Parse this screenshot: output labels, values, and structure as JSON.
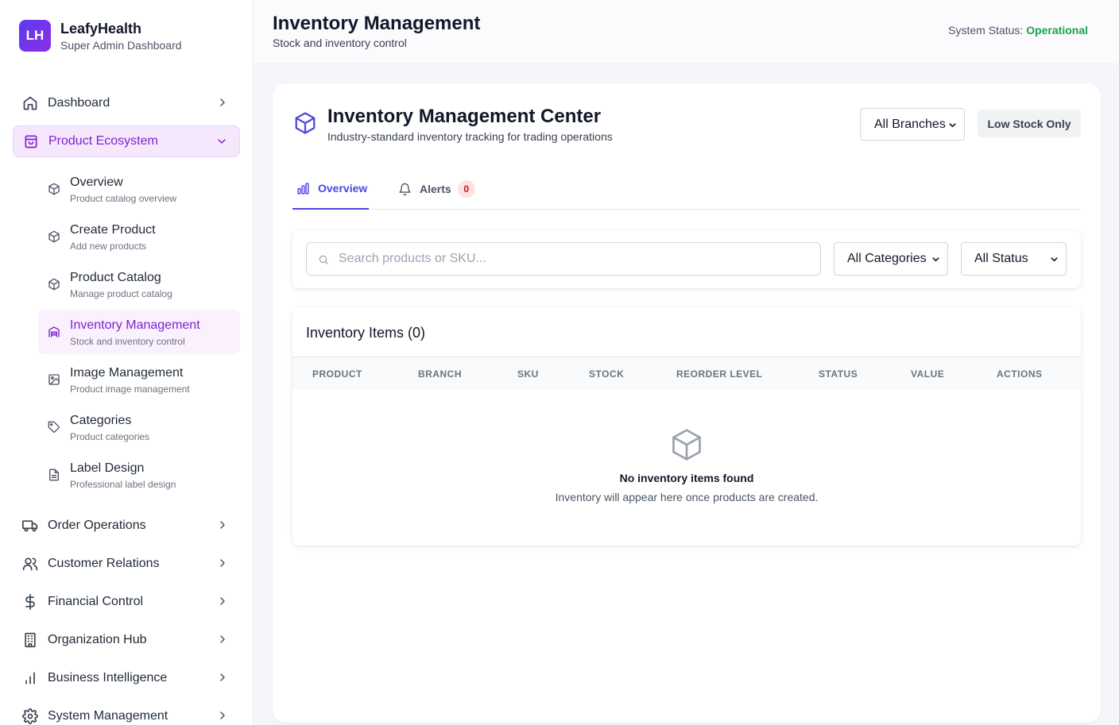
{
  "brand": {
    "logo": "LH",
    "name": "LeafyHealth",
    "subtitle": "Super Admin Dashboard"
  },
  "sidebar": {
    "top": {
      "label": "Dashboard",
      "icon": "home-icon"
    },
    "active_section": {
      "label": "Product Ecosystem",
      "icon": "shopping-bag-icon"
    },
    "sub_items": [
      {
        "title": "Overview",
        "desc": "Product catalog overview",
        "icon": "package-icon"
      },
      {
        "title": "Create Product",
        "desc": "Add new products",
        "icon": "package-icon"
      },
      {
        "title": "Product Catalog",
        "desc": "Manage product catalog",
        "icon": "package-icon"
      },
      {
        "title": "Inventory Management",
        "desc": "Stock and inventory control",
        "icon": "warehouse-icon",
        "active": true
      },
      {
        "title": "Image Management",
        "desc": "Product image management",
        "icon": "image-icon"
      },
      {
        "title": "Categories",
        "desc": "Product categories",
        "icon": "tag-icon"
      },
      {
        "title": "Label Design",
        "desc": "Professional label design",
        "icon": "file-text-icon"
      }
    ],
    "sections": [
      {
        "label": "Order Operations",
        "icon": "truck-icon"
      },
      {
        "label": "Customer Relations",
        "icon": "users-icon"
      },
      {
        "label": "Financial Control",
        "icon": "dollar-icon"
      },
      {
        "label": "Organization Hub",
        "icon": "building-icon"
      },
      {
        "label": "Business Intelligence",
        "icon": "bar-chart-icon"
      },
      {
        "label": "System Management",
        "icon": "gear-icon"
      }
    ]
  },
  "header": {
    "title": "Inventory Management",
    "subtitle": "Stock and inventory control",
    "status_label": "System Status:",
    "status_value": "Operational",
    "status_color": "#16a34a"
  },
  "main": {
    "title": "Inventory Management Center",
    "subtitle": "Industry-standard inventory tracking for trading operations",
    "branch_select": "All Branches",
    "low_stock_button": "Low Stock Only",
    "tabs": [
      {
        "label": "Overview",
        "icon": "bar-chart-icon",
        "active": true
      },
      {
        "label": "Alerts",
        "icon": "bell-icon",
        "badge": "0"
      }
    ],
    "search_placeholder": "Search products or SKU...",
    "category_select": "All Categories",
    "status_select": "All Status",
    "table": {
      "title": "Inventory Items (0)",
      "columns": [
        "PRODUCT",
        "BRANCH",
        "SKU",
        "STOCK",
        "REORDER LEVEL",
        "STATUS",
        "VALUE",
        "ACTIONS"
      ],
      "empty_title": "No inventory items found",
      "empty_subtitle": "Inventory will appear here once products are created."
    }
  },
  "colors": {
    "accent": "#4f46e5",
    "active_purple": "#7e22ce",
    "badge_bg": "#fde2e2"
  }
}
